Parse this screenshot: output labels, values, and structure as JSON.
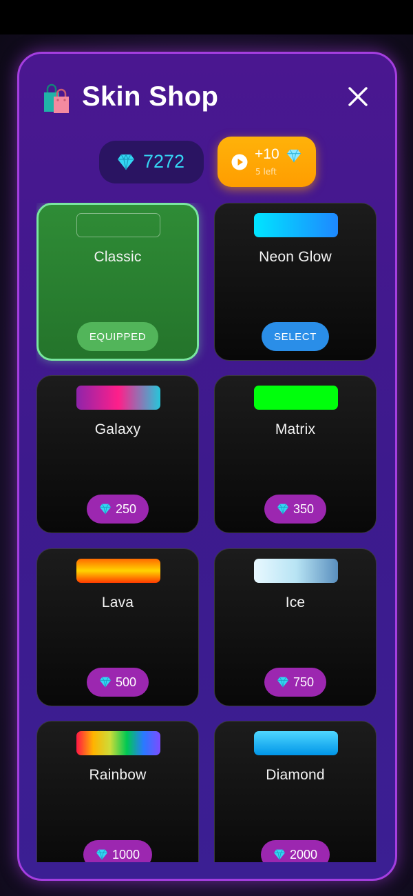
{
  "header": {
    "title": "Skin Shop",
    "icon": "shopping-bags-icon",
    "close_icon": "close-icon"
  },
  "wallet": {
    "gems": "7272",
    "gem_color": "#35d6f4"
  },
  "reward": {
    "amount": "+10",
    "remaining": "5 left",
    "icon": "play-icon"
  },
  "skins": [
    {
      "name": "Classic",
      "status": "equipped",
      "action_label": "EQUIPPED",
      "swatch": "outline"
    },
    {
      "name": "Neon Glow",
      "status": "owned",
      "action_label": "SELECT",
      "swatch": "linear-gradient(90deg,#00e5ff,#1e88ff)"
    },
    {
      "name": "Galaxy",
      "status": "locked",
      "price": "250",
      "swatch": "linear-gradient(90deg,#8e24aa,#ff1f8a,#26c6da)"
    },
    {
      "name": "Matrix",
      "status": "locked",
      "price": "350",
      "swatch": "#00ff0c"
    },
    {
      "name": "Lava",
      "status": "locked",
      "price": "500",
      "swatch": "linear-gradient(180deg,#ff6a00,#ffd400,#ff3c00)"
    },
    {
      "name": "Ice",
      "status": "locked",
      "price": "750",
      "swatch": "linear-gradient(90deg,#e8f8ff,#b8e4f4,#5a8fbe)"
    },
    {
      "name": "Rainbow",
      "status": "locked",
      "price": "1000",
      "swatch": "linear-gradient(90deg,#ff1744,#ffb300,#cddc39,#00c853,#2979ff,#7c4dff)"
    },
    {
      "name": "Diamond",
      "status": "locked",
      "price": "2000",
      "swatch": "linear-gradient(180deg,#4fd7ff,#0095e8)"
    }
  ],
  "colors": {
    "modal_border": "#a53ee0",
    "equipped_button": "#52b55a",
    "select_button": "#2a8ee8",
    "price_button": "#9c27b0"
  }
}
